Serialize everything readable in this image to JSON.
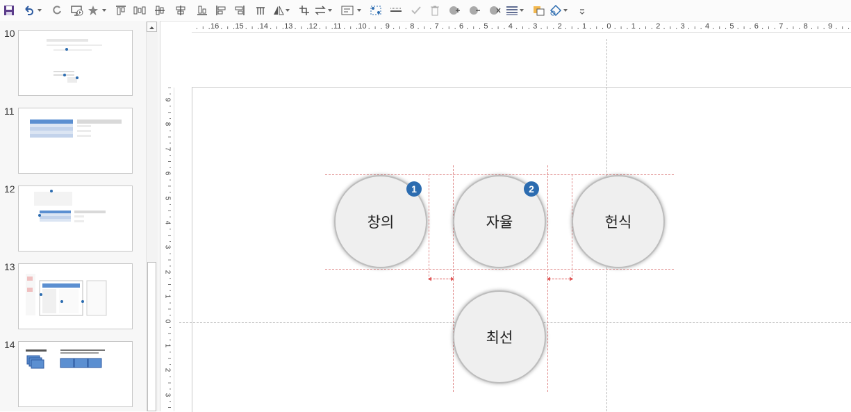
{
  "toolbar": {
    "buttons": [
      "save-icon",
      "undo-icon",
      "redo-icon",
      "slideshow-icon",
      "star-icon",
      "align-top-icon",
      "distribute-icon",
      "align-middle-icon",
      "align-center-icon",
      "align-bottom-icon",
      "align-left-icon",
      "align-right-icon",
      "flip-icon",
      "rotate-icon",
      "crop-icon",
      "swap-icon",
      "textbox-icon",
      "select-icon",
      "line-icon",
      "check-icon",
      "delete-icon",
      "shape-add-icon",
      "shape-subtract-icon",
      "shape-intersect-icon",
      "lines-icon",
      "fill-icon",
      "effects-icon",
      "more-icon"
    ]
  },
  "slides": [
    {
      "number": "10"
    },
    {
      "number": "11"
    },
    {
      "number": "12"
    },
    {
      "number": "13"
    },
    {
      "number": "14"
    }
  ],
  "ruler": {
    "horizontal": [
      "16",
      "15",
      "14",
      "13",
      "12",
      "11",
      "10",
      "9",
      "8",
      "7",
      "6",
      "5",
      "4",
      "3",
      "2",
      "1",
      "0",
      "1",
      "2",
      "3",
      "4",
      "5",
      "6",
      "7",
      "8",
      "9"
    ],
    "vertical": [
      "9",
      "8",
      "7",
      "6",
      "5",
      "4",
      "3",
      "2",
      "1",
      "0",
      "1",
      "2",
      "3"
    ]
  },
  "shapes": {
    "circles": [
      {
        "label": "창의",
        "badge": "1"
      },
      {
        "label": "자율",
        "badge": "2"
      },
      {
        "label": "헌식",
        "badge": ""
      },
      {
        "label": "최선",
        "badge": ""
      }
    ]
  },
  "colors": {
    "badge": "#2c6cb0",
    "guide": "#e08a8a",
    "circle_fill": "#efefef"
  }
}
